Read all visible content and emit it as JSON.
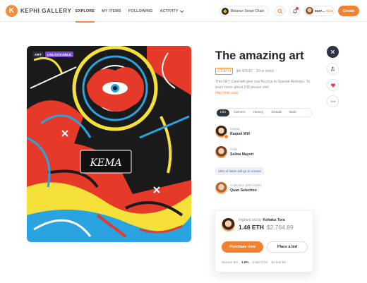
{
  "header": {
    "brand": "KEPHI GALLERY",
    "logo_letter": "K",
    "nav": [
      {
        "label": "EXPLORE"
      },
      {
        "label": "MY ITEMS"
      },
      {
        "label": "FOLLOWING"
      },
      {
        "label": "ACTIVITY"
      }
    ],
    "chain_label": "Binance Smart Chain",
    "wallet_amount": "9237...",
    "wallet_currency": "KCG",
    "create_label": "Create"
  },
  "item": {
    "badges": [
      "ART",
      "UNLOCKABLE"
    ],
    "title": "The amazing art",
    "price_eth": "2.5 ETH",
    "price_usd": "$4,429.87",
    "stock": "10 in stock",
    "description": "This NFT Card will give you Access to Special Airdrops. To learn more about UI8 please visit",
    "description_link": "http://site.com",
    "artwork_text": "KEMA"
  },
  "tabs": [
    {
      "label": "Info"
    },
    {
      "label": "Owners"
    },
    {
      "label": "History"
    },
    {
      "label": "Details"
    },
    {
      "label": "Bids"
    }
  ],
  "people": [
    {
      "role": "Owner",
      "name": "Raquel Will"
    },
    {
      "role": "Artist",
      "name": "Selina Mayert"
    },
    {
      "role": "Collection (ERC1155)",
      "name": "Quan Selection"
    }
  ],
  "royalty_note": "15% of sales will go to creator",
  "bid": {
    "highest_label": "Highest bid by",
    "bidder": "Kohaku Tora",
    "amount_eth": "1.46 ETH",
    "amount_usd": "$2,764.89",
    "purchase_label": "Purchase now",
    "place_bid_label": "Place a bid",
    "fee_label": "Service fee",
    "fee_pct": "1.5%",
    "fee_eth": "2.563 ETH",
    "fee_usd": "$4,540.62"
  },
  "icons": {
    "close": "close-icon",
    "share": "share-icon",
    "like": "heart-icon",
    "more": "more-icon"
  },
  "colors": {
    "accent": "#f08232",
    "dark": "#2d3140",
    "heart": "#e6404e"
  }
}
